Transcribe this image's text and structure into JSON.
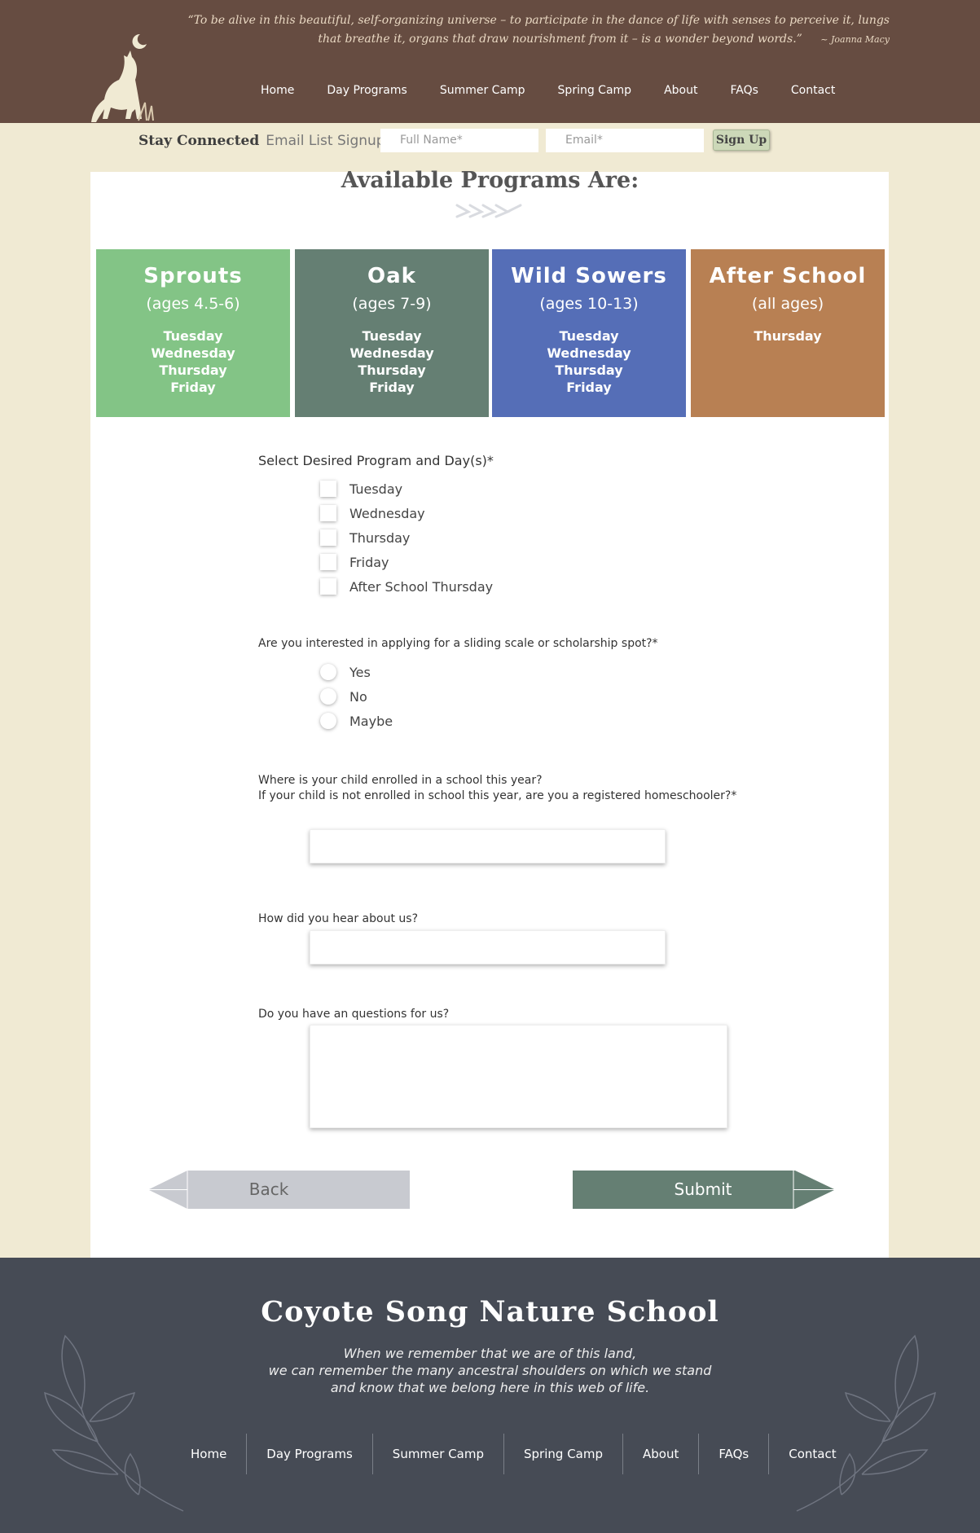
{
  "header": {
    "quote": "“To be alive in this beautiful, self-organizing universe – to participate in the dance of life with senses to perceive it, lungs that breathe it, organs that draw nourishment from it – is a wonder beyond words.”",
    "quote_author": "~ Joanna Macy",
    "nav": [
      "Home",
      "Day Programs",
      "Summer Camp",
      "Spring Camp",
      "About",
      "FAQs",
      "Contact"
    ]
  },
  "stay_connected": {
    "title": "Stay Connected",
    "subtitle": "Email List Signup",
    "name_placeholder": "Full Name*",
    "email_placeholder": "Email*",
    "button": "Sign Up"
  },
  "programs": {
    "title": "Available Programs Are:",
    "cards": [
      {
        "name": "Sprouts",
        "ages": "(ages 4.5-6)",
        "days": [
          "Tuesday",
          "Wednesday",
          "Thursday",
          "Friday"
        ],
        "color": "#83c486"
      },
      {
        "name": "Oak",
        "ages": "(ages 7-9)",
        "days": [
          "Tuesday",
          "Wednesday",
          "Thursday",
          "Friday"
        ],
        "color": "#657f73"
      },
      {
        "name": "Wild Sowers",
        "ages": "(ages 10-13)",
        "days": [
          "Tuesday",
          "Wednesday",
          "Thursday",
          "Friday"
        ],
        "color": "#556eb7"
      },
      {
        "name": "After School",
        "ages": "(all ages)",
        "days": [
          "Thursday"
        ],
        "color": "#b88053"
      }
    ]
  },
  "form": {
    "days_label": "Select Desired Program and Day(s)*",
    "day_options": [
      "Tuesday",
      "Wednesday",
      "Thursday",
      "Friday",
      "After School Thursday"
    ],
    "scholarship_label": "Are you interested in applying for a sliding scale or scholarship spot?*",
    "scholarship_options": [
      "Yes",
      "No",
      "Maybe"
    ],
    "school_label_1": "Where is your child enrolled in a school this year?",
    "school_label_2": "If your child is not enrolled in school this year, are you a registered homeschooler?*",
    "hear_label": "How did you hear about us?",
    "questions_label": "Do you have an questions for us?",
    "back_button": "Back",
    "submit_button": "Submit"
  },
  "footer": {
    "title": "Coyote Song Nature School",
    "quote_lines": [
      "When we remember that we are of this land,",
      "we can remember the many ancestral shoulders on which we stand",
      "and know that we belong here in this web of life."
    ],
    "nav": [
      "Home",
      "Day Programs",
      "Summer Camp",
      "Spring Camp",
      "About",
      "FAQs",
      "Contact"
    ]
  },
  "colors": {
    "header_bg": "#664c41",
    "page_bg": "#f0ead3",
    "footer_bg": "#464b55",
    "submit_bg": "#657f73",
    "back_bg": "#c8cad0"
  }
}
